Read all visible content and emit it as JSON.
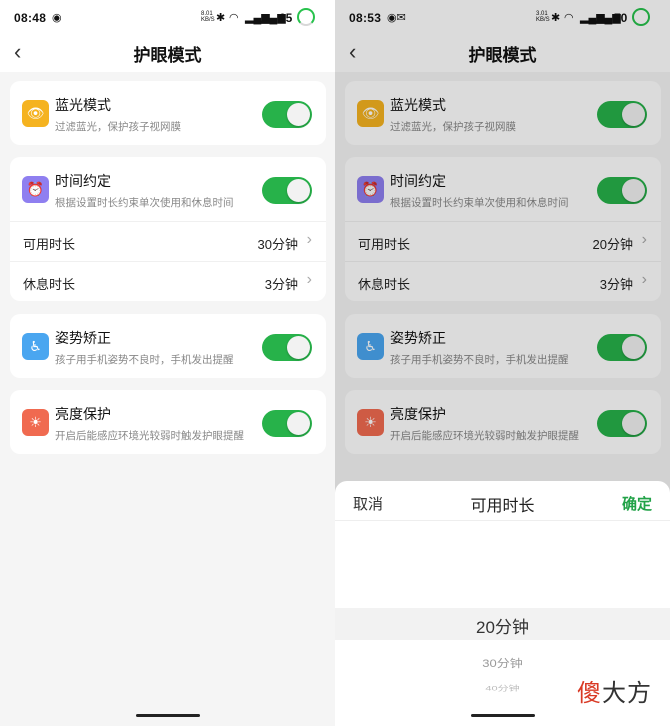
{
  "left": {
    "status": {
      "time": "08:48",
      "net_speed": "8.01 KB/S",
      "battery": "65"
    },
    "nav": {
      "back": "‹",
      "title": "护眼模式"
    },
    "blue_light": {
      "icon": "eye-icon",
      "title": "蓝光模式",
      "desc": "过滤蓝光，保护孩子视网膜",
      "enabled": true,
      "color": "#f5b320"
    },
    "time_limit": {
      "icon": "alarm-clock-icon",
      "title": "时间约定",
      "desc": "根据设置时长约束单次使用和休息时间",
      "enabled": true,
      "color": "#8f7ff0",
      "usable_label": "可用时长",
      "usable_value": "30分钟",
      "rest_label": "休息时长",
      "rest_value": "3分钟"
    },
    "posture": {
      "icon": "sitting-person-icon",
      "title": "姿势矫正",
      "desc": "孩子用手机姿势不良时，手机发出提醒",
      "enabled": true,
      "color": "#4aa6f0"
    },
    "brightness": {
      "icon": "sun-icon",
      "title": "亮度保护",
      "desc": "开启后能感应环境光较弱时触发护眼提醒",
      "enabled": true,
      "color": "#f06a50"
    }
  },
  "right": {
    "status": {
      "time": "08:53",
      "net_speed": "3.01 KB/S",
      "battery": "70"
    },
    "nav": {
      "back": "‹",
      "title": "护眼模式"
    },
    "blue_light": {
      "title": "蓝光模式",
      "desc": "过滤蓝光，保护孩子视网膜"
    },
    "time_limit": {
      "title": "时间约定",
      "desc": "根据设置时长约束单次使用和休息时间",
      "usable_label": "可用时长",
      "usable_value": "20分钟",
      "rest_label": "休息时长",
      "rest_value": "3分钟"
    },
    "posture": {
      "title": "姿势矫正",
      "desc": "孩子用手机姿势不良时，手机发出提醒"
    },
    "brightness": {
      "title": "亮度保护",
      "desc": "开启后能感应环境光较弱时触发护眼提醒"
    },
    "sheet": {
      "cancel": "取消",
      "title": "可用时长",
      "confirm": "确定",
      "options": [
        "20分钟",
        "30分钟",
        "40分钟"
      ]
    }
  },
  "watermark": {
    "first": "傻",
    "rest": "大方"
  },
  "colors": {
    "accent_green": "#27b24a",
    "confirm_green": "#22a248"
  }
}
